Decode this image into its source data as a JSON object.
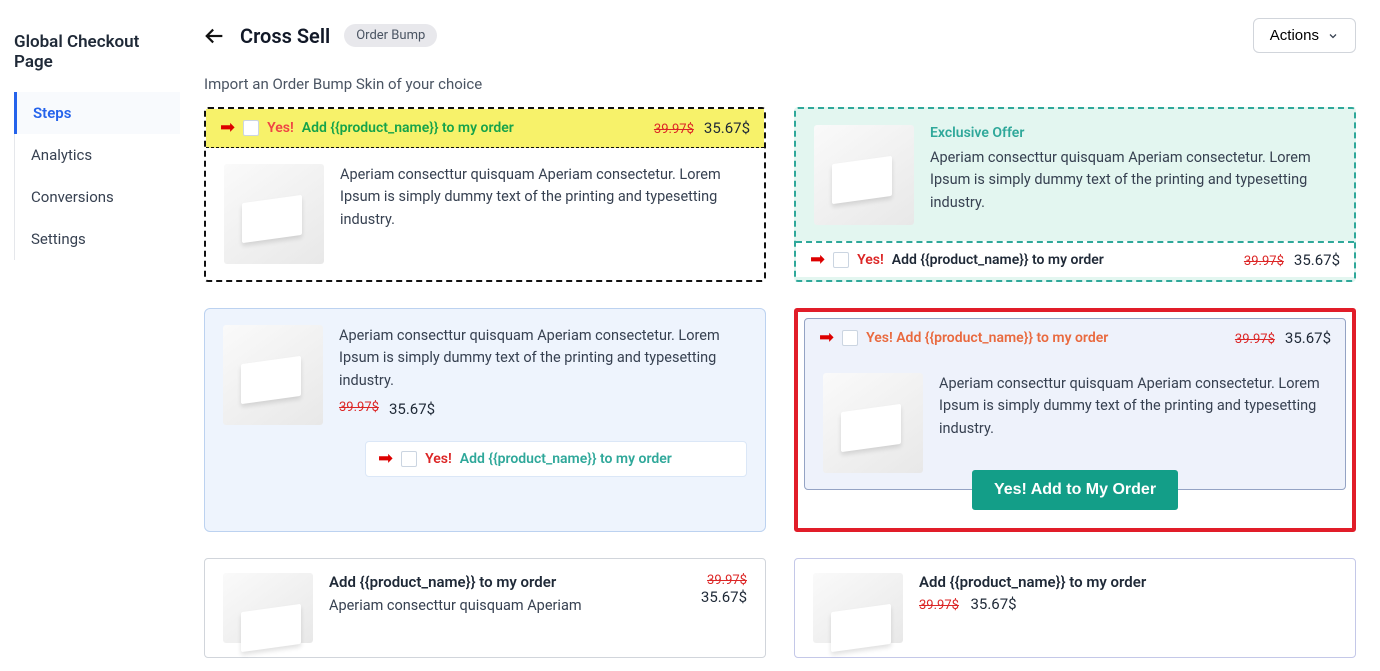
{
  "sidebar": {
    "title": "Global Checkout Page",
    "items": [
      "Steps",
      "Analytics",
      "Conversions",
      "Settings"
    ],
    "active": 0
  },
  "header": {
    "title": "Cross Sell",
    "badge": "Order Bump",
    "actions": "Actions"
  },
  "subheading": "Import an Order Bump Skin of your choice",
  "common": {
    "yes": "Yes!",
    "add_line": "Add {{product_name}} to my order",
    "desc": "Aperiam consecttur quisquam Aperiam consectetur. Lorem Ipsum is simply dummy text of the printing and typesetting industry.",
    "price_old": "39.97$",
    "price_new": "35.67$"
  },
  "card2": {
    "exclusive": "Exclusive Offer"
  },
  "card4": {
    "topline": "Yes! Add {{product_name}} to my order",
    "button": "Yes! Add to My Order"
  },
  "card56": {
    "title": "Add {{product_name}} to my order",
    "desc5": "Aperiam consecttur quisquam Aperiam"
  }
}
